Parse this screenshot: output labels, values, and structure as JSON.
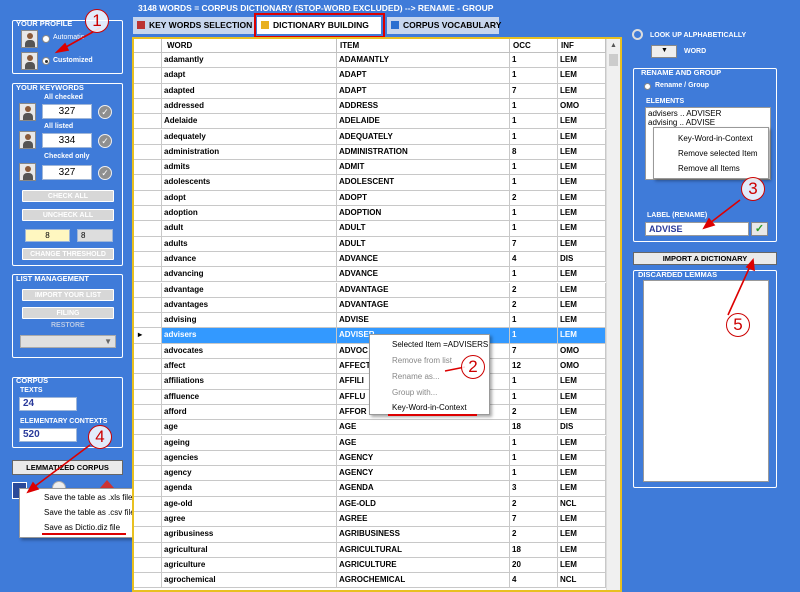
{
  "title": "3148 WORDS = CORPUS DICTIONARY (STOP-WORD EXCLUDED) --> RENAME - GROUP",
  "tabs": [
    {
      "label": "KEY WORDS SELECTION"
    },
    {
      "label": "DICTIONARY BUILDING"
    },
    {
      "label": "CORPUS VOCABULARY"
    }
  ],
  "profile": {
    "title": "YOUR PROFILE",
    "automatic": "Automatic",
    "customized": "Customized"
  },
  "keywords": {
    "title": "YOUR KEYWORDS",
    "all_checked": "All checked",
    "all_checked_value": "327",
    "all_listed": "All listed",
    "all_listed_value": "334",
    "checked_only": "Checked only",
    "checked_only_value": "327",
    "check_all": "CHECK ALL",
    "uncheck_all": "UNCHECK ALL",
    "thr1": "8",
    "thr2": "8",
    "change_threshold": "CHANGE THRESHOLD"
  },
  "listmgmt": {
    "title": "LIST MANAGEMENT",
    "import": "IMPORT YOUR LIST",
    "filing": "FILING",
    "restore": "RESTORE"
  },
  "corpus": {
    "title": "CORPUS",
    "texts": "TEXTS",
    "texts_value": "24",
    "ec": "ELEMENTARY CONTEXTS",
    "ec_value": "520"
  },
  "lemmatized": "LEMMATIZED CORPUS",
  "save_menu": [
    "Save the table as .xls file",
    "Save the table as .csv file",
    "Save as Dictio.diz file"
  ],
  "grid": {
    "headers": [
      "WORD",
      "ITEM",
      "OCC",
      "INF"
    ],
    "rows": [
      [
        "adamantly",
        "ADAMANTLY",
        "1",
        "LEM"
      ],
      [
        "adapt",
        "ADAPT",
        "1",
        "LEM"
      ],
      [
        "adapted",
        "ADAPT",
        "7",
        "LEM"
      ],
      [
        "addressed",
        "ADDRESS",
        "1",
        "OMO"
      ],
      [
        "Adelaide",
        "ADELAIDE",
        "1",
        "LEM"
      ],
      [
        "adequately",
        "ADEQUATELY",
        "1",
        "LEM"
      ],
      [
        "administration",
        "ADMINISTRATION",
        "8",
        "LEM"
      ],
      [
        "admits",
        "ADMIT",
        "1",
        "LEM"
      ],
      [
        "adolescents",
        "ADOLESCENT",
        "1",
        "LEM"
      ],
      [
        "adopt",
        "ADOPT",
        "2",
        "LEM"
      ],
      [
        "adoption",
        "ADOPTION",
        "1",
        "LEM"
      ],
      [
        "adult",
        "ADULT",
        "1",
        "LEM"
      ],
      [
        "adults",
        "ADULT",
        "7",
        "LEM"
      ],
      [
        "advance",
        "ADVANCE",
        "4",
        "DIS"
      ],
      [
        "advancing",
        "ADVANCE",
        "1",
        "LEM"
      ],
      [
        "advantage",
        "ADVANTAGE",
        "2",
        "LEM"
      ],
      [
        "advantages",
        "ADVANTAGE",
        "2",
        "LEM"
      ],
      [
        "advising",
        "ADVISE",
        "1",
        "LEM"
      ],
      [
        "advisers",
        "ADVISER",
        "1",
        "LEM"
      ],
      [
        "advocates",
        "ADVOC",
        "7",
        "OMO"
      ],
      [
        "affect",
        "AFFECT",
        "12",
        "OMO"
      ],
      [
        "affiliations",
        "AFFILI",
        "1",
        "LEM"
      ],
      [
        "affluence",
        "AFFLU",
        "1",
        "LEM"
      ],
      [
        "afford",
        "AFFOR",
        "2",
        "LEM"
      ],
      [
        "age",
        "AGE",
        "18",
        "DIS"
      ],
      [
        "ageing",
        "AGE",
        "1",
        "LEM"
      ],
      [
        "agencies",
        "AGENCY",
        "1",
        "LEM"
      ],
      [
        "agency",
        "AGENCY",
        "1",
        "LEM"
      ],
      [
        "agenda",
        "AGENDA",
        "3",
        "LEM"
      ],
      [
        "age-old",
        "AGE-OLD",
        "2",
        "NCL"
      ],
      [
        "agree",
        "AGREE",
        "7",
        "LEM"
      ],
      [
        "agribusiness",
        "AGRIBUSINESS",
        "2",
        "LEM"
      ],
      [
        "agricultural",
        "AGRICULTURAL",
        "18",
        "LEM"
      ],
      [
        "agriculture",
        "AGRICULTURE",
        "20",
        "LEM"
      ],
      [
        "agrochemical",
        "AGROCHEMICAL",
        "4",
        "NCL"
      ]
    ]
  },
  "context_menu": [
    "Selected Item =ADVISERS",
    "Remove from list",
    "Rename as...",
    "Group with...",
    "Key-Word-in-Context"
  ],
  "lookup": {
    "title": "LOOK UP ALPHABETICALLY",
    "word": "WORD"
  },
  "rename": {
    "title": "RENAME AND GROUP",
    "radio": "Rename / Group",
    "elements": "ELEMENTS",
    "items": [
      "advisers .. ADVISER",
      "advising .. ADVISE"
    ],
    "menu": [
      "Key-Word-in-Context",
      "Remove selected Item",
      "Remove all Items"
    ],
    "label": "LABEL (RENAME)",
    "label_value": "ADVISE"
  },
  "import_dict": "IMPORT A DICTIONARY",
  "discarded": "DISCARDED LEMMAS",
  "annotations": [
    "1",
    "2",
    "3",
    "4",
    "5"
  ]
}
